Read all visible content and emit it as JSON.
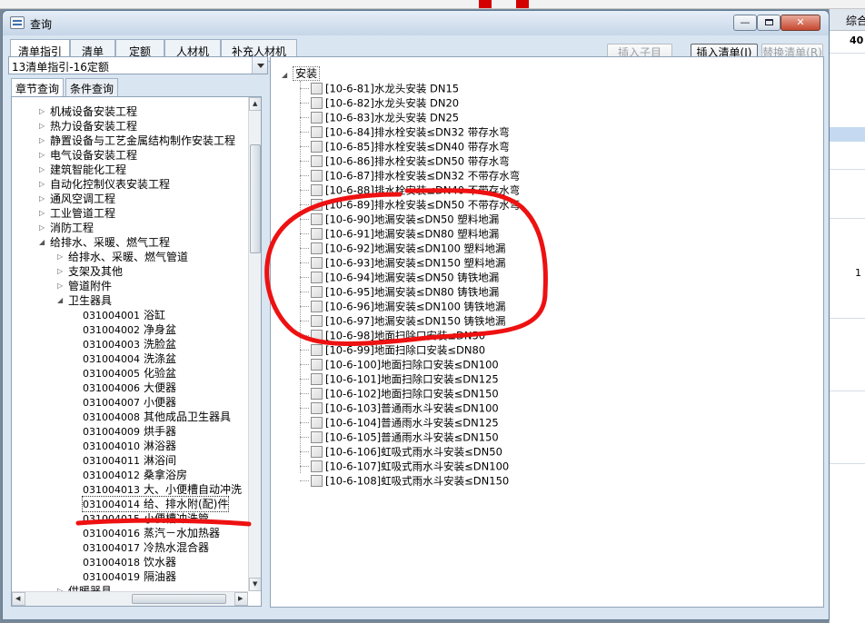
{
  "window": {
    "title": "查询",
    "close_label": "✕",
    "min_label": "—"
  },
  "tabs": [
    "清单指引",
    "清单",
    "定额",
    "人材机",
    "补充人材机"
  ],
  "toolbar": {
    "insert_child": "插入子目",
    "insert_list": "插入清单(I)",
    "replace_list": "替换清单(R)"
  },
  "left": {
    "dictionary": "13清单指引-16定额",
    "subtabs": [
      "章节查询",
      "条件查询"
    ],
    "tree": [
      {
        "label": "机械设备安装工程",
        "level": 1,
        "state": "collapsed"
      },
      {
        "label": "热力设备安装工程",
        "level": 1,
        "state": "collapsed"
      },
      {
        "label": "静置设备与工艺金属结构制作安装工程",
        "level": 1,
        "state": "collapsed"
      },
      {
        "label": "电气设备安装工程",
        "level": 1,
        "state": "collapsed"
      },
      {
        "label": "建筑智能化工程",
        "level": 1,
        "state": "collapsed"
      },
      {
        "label": "自动化控制仪表安装工程",
        "level": 1,
        "state": "collapsed"
      },
      {
        "label": "通风空调工程",
        "level": 1,
        "state": "collapsed"
      },
      {
        "label": "工业管道工程",
        "level": 1,
        "state": "collapsed"
      },
      {
        "label": "消防工程",
        "level": 1,
        "state": "collapsed"
      },
      {
        "label": "给排水、采暖、燃气工程",
        "level": 1,
        "state": "expanded"
      },
      {
        "label": "给排水、采暖、燃气管道",
        "level": 2,
        "state": "collapsed"
      },
      {
        "label": "支架及其他",
        "level": 2,
        "state": "collapsed"
      },
      {
        "label": "管道附件",
        "level": 2,
        "state": "collapsed"
      },
      {
        "label": "卫生器具",
        "level": 2,
        "state": "expanded"
      },
      {
        "code": "031004001",
        "label": "浴缸",
        "level": 3
      },
      {
        "code": "031004002",
        "label": "净身盆",
        "level": 3
      },
      {
        "code": "031004003",
        "label": "洗脸盆",
        "level": 3
      },
      {
        "code": "031004004",
        "label": "洗涤盆",
        "level": 3
      },
      {
        "code": "031004005",
        "label": "化验盆",
        "level": 3
      },
      {
        "code": "031004006",
        "label": "大便器",
        "level": 3
      },
      {
        "code": "031004007",
        "label": "小便器",
        "level": 3
      },
      {
        "code": "031004008",
        "label": "其他成品卫生器具",
        "level": 3
      },
      {
        "code": "031004009",
        "label": "烘手器",
        "level": 3
      },
      {
        "code": "031004010",
        "label": "淋浴器",
        "level": 3
      },
      {
        "code": "031004011",
        "label": "淋浴间",
        "level": 3
      },
      {
        "code": "031004012",
        "label": "桑拿浴房",
        "level": 3
      },
      {
        "code": "031004013",
        "label": "大、小便槽自动冲洗",
        "level": 3
      },
      {
        "code": "031004014",
        "label": "给、排水附(配)件",
        "level": 3,
        "selected": true
      },
      {
        "code": "031004015",
        "label": "小便槽冲洗管",
        "level": 3
      },
      {
        "code": "031004016",
        "label": "蒸汽－水加热器",
        "level": 3
      },
      {
        "code": "031004017",
        "label": "冷热水混合器",
        "level": 3
      },
      {
        "code": "031004018",
        "label": "饮水器",
        "level": 3
      },
      {
        "code": "031004019",
        "label": "隔油器",
        "level": 3
      },
      {
        "label": "供暖器具",
        "level": 2,
        "state": "collapsed"
      }
    ]
  },
  "right": {
    "root": "安装",
    "items": [
      "[10-6-81]水龙头安装 DN15",
      "[10-6-82]水龙头安装 DN20",
      "[10-6-83]水龙头安装 DN25",
      "[10-6-84]排水栓安装≤DN32 带存水弯",
      "[10-6-85]排水栓安装≤DN40 带存水弯",
      "[10-6-86]排水栓安装≤DN50 带存水弯",
      "[10-6-87]排水栓安装≤DN32 不带存水弯",
      "[10-6-88]排水栓安装≤DN40 不带存水弯",
      "[10-6-89]排水栓安装≤DN50 不带存水弯",
      "[10-6-90]地漏安装≤DN50 塑料地漏",
      "[10-6-91]地漏安装≤DN80 塑料地漏",
      "[10-6-92]地漏安装≤DN100 塑料地漏",
      "[10-6-93]地漏安装≤DN150 塑料地漏",
      "[10-6-94]地漏安装≤DN50 铸铁地漏",
      "[10-6-95]地漏安装≤DN80 铸铁地漏",
      "[10-6-96]地漏安装≤DN100 铸铁地漏",
      "[10-6-97]地漏安装≤DN150 铸铁地漏",
      "[10-6-98]地面扫除口安装≤DN50",
      "[10-6-99]地面扫除口安装≤DN80",
      "[10-6-100]地面扫除口安装≤DN100",
      "[10-6-101]地面扫除口安装≤DN125",
      "[10-6-102]地面扫除口安装≤DN150",
      "[10-6-103]普通雨水斗安装≤DN100",
      "[10-6-104]普通雨水斗安装≤DN125",
      "[10-6-105]普通雨水斗安装≤DN150",
      "[10-6-106]虹吸式雨水斗安装≤DN50",
      "[10-6-107]虹吸式雨水斗安装≤DN100",
      "[10-6-108]虹吸式雨水斗安装≤DN150"
    ]
  },
  "background": {
    "header": "综合",
    "value_top": "40",
    "value_mid": "1"
  },
  "colors": {
    "annotation": "#ee1111",
    "window_bg": "#d9e5f1"
  }
}
